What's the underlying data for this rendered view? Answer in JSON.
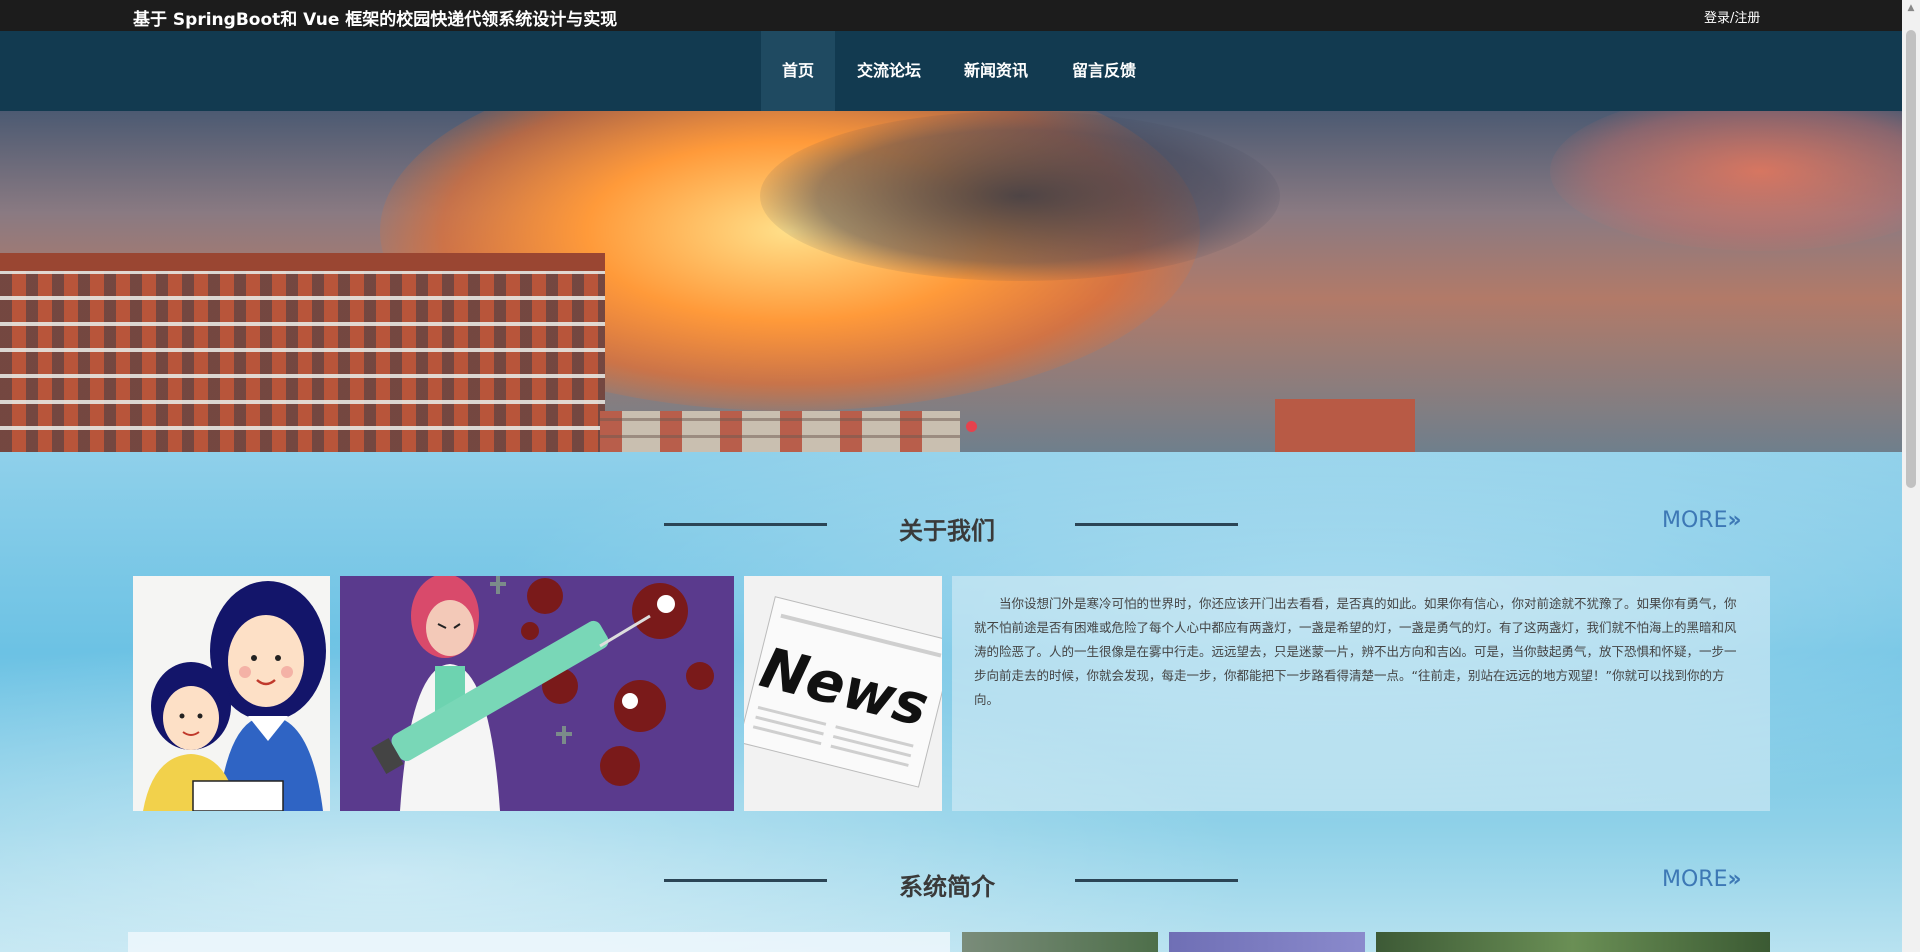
{
  "header": {
    "title": "基于 SpringBoot和 Vue 框架的校园快递代领系统设计与实现",
    "login_label": "登录/注册"
  },
  "nav": {
    "items": [
      {
        "label": "首页",
        "active": true
      },
      {
        "label": "交流论坛",
        "active": false
      },
      {
        "label": "新闻资讯",
        "active": false
      },
      {
        "label": "留言反馈",
        "active": false
      }
    ]
  },
  "banner": {
    "slides_total": 1,
    "active_slide": 1
  },
  "about": {
    "title": "关于我们",
    "more_label": "MORE",
    "more_icon": "double-chevron-right-icon",
    "text": "当你设想门外是寒冷可怕的世界时，你还应该开门出去看看，是否真的如此。如果你有信心，你对前途就不犹豫了。如果你有勇气，你就不怕前途是否有困难或危险了每个人心中都应有两盏灯，一盏是希望的灯，一盏是勇气的灯。有了这两盏灯，我们就不怕海上的黑暗和风涛的险恶了。人的一生很像是在雾中行走。远远望去，只是迷蒙一片，辨不出方向和吉凶。可是，当你鼓起勇气，放下恐惧和怀疑，一步一步向前走去的时候，你就会发现，每走一步，你都能把下一步路看得清楚一点。“往前走，别站在远远的地方观望！”你就可以找到你的方向。",
    "images": [
      {
        "icon": "mother-daughter-illustration"
      },
      {
        "icon": "doctor-syringe-virus-illustration"
      },
      {
        "icon": "newspaper-illustration",
        "caption": "News"
      }
    ]
  },
  "intro": {
    "title": "系统简介",
    "more_label": "MORE"
  },
  "colors": {
    "topbar": "#1c1c1c",
    "nav": "#123a50",
    "nav_active": "#1f4a61",
    "accent_more": "#3d78b5",
    "banner_dot": "#e5424d"
  }
}
